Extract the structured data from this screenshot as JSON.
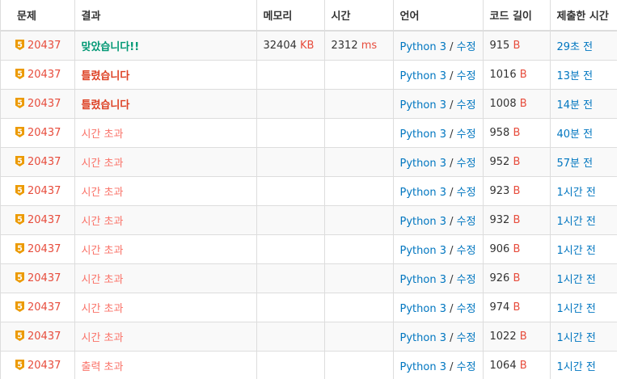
{
  "columns": {
    "problem": "문제",
    "result": "결과",
    "memory": "메모리",
    "time": "시간",
    "language": "언어",
    "code_length": "코드 길이",
    "submitted": "제출한 시간"
  },
  "colors": {
    "accepted": "#009874",
    "wrong": "#dd4124",
    "timeout": "#fa7268",
    "link": "#0076c0",
    "tier_gold": "#ec9a00"
  },
  "rows": [
    {
      "tier": "5",
      "problem": "20437",
      "result": "맞았습니다!!",
      "result_type": "ac",
      "memory": "32404",
      "memory_unit": "KB",
      "time": "2312",
      "time_unit": "ms",
      "language": "Python 3",
      "separator": " / ",
      "edit": "수정",
      "length": "915",
      "length_unit": "B",
      "submitted": "29초 전"
    },
    {
      "tier": "5",
      "problem": "20437",
      "result": "틀렸습니다",
      "result_type": "wa",
      "memory": "",
      "memory_unit": "",
      "time": "",
      "time_unit": "",
      "language": "Python 3",
      "separator": " / ",
      "edit": "수정",
      "length": "1016",
      "length_unit": "B",
      "submitted": "13분 전"
    },
    {
      "tier": "5",
      "problem": "20437",
      "result": "틀렸습니다",
      "result_type": "wa",
      "memory": "",
      "memory_unit": "",
      "time": "",
      "time_unit": "",
      "language": "Python 3",
      "separator": " / ",
      "edit": "수정",
      "length": "1008",
      "length_unit": "B",
      "submitted": "14분 전"
    },
    {
      "tier": "5",
      "problem": "20437",
      "result": "시간 초과",
      "result_type": "tle",
      "memory": "",
      "memory_unit": "",
      "time": "",
      "time_unit": "",
      "language": "Python 3",
      "separator": " / ",
      "edit": "수정",
      "length": "958",
      "length_unit": "B",
      "submitted": "40분 전"
    },
    {
      "tier": "5",
      "problem": "20437",
      "result": "시간 초과",
      "result_type": "tle",
      "memory": "",
      "memory_unit": "",
      "time": "",
      "time_unit": "",
      "language": "Python 3",
      "separator": " / ",
      "edit": "수정",
      "length": "952",
      "length_unit": "B",
      "submitted": "57분 전"
    },
    {
      "tier": "5",
      "problem": "20437",
      "result": "시간 초과",
      "result_type": "tle",
      "memory": "",
      "memory_unit": "",
      "time": "",
      "time_unit": "",
      "language": "Python 3",
      "separator": " / ",
      "edit": "수정",
      "length": "923",
      "length_unit": "B",
      "submitted": "1시간 전"
    },
    {
      "tier": "5",
      "problem": "20437",
      "result": "시간 초과",
      "result_type": "tle",
      "memory": "",
      "memory_unit": "",
      "time": "",
      "time_unit": "",
      "language": "Python 3",
      "separator": " / ",
      "edit": "수정",
      "length": "932",
      "length_unit": "B",
      "submitted": "1시간 전"
    },
    {
      "tier": "5",
      "problem": "20437",
      "result": "시간 초과",
      "result_type": "tle",
      "memory": "",
      "memory_unit": "",
      "time": "",
      "time_unit": "",
      "language": "Python 3",
      "separator": " / ",
      "edit": "수정",
      "length": "906",
      "length_unit": "B",
      "submitted": "1시간 전"
    },
    {
      "tier": "5",
      "problem": "20437",
      "result": "시간 초과",
      "result_type": "tle",
      "memory": "",
      "memory_unit": "",
      "time": "",
      "time_unit": "",
      "language": "Python 3",
      "separator": " / ",
      "edit": "수정",
      "length": "926",
      "length_unit": "B",
      "submitted": "1시간 전"
    },
    {
      "tier": "5",
      "problem": "20437",
      "result": "시간 초과",
      "result_type": "tle",
      "memory": "",
      "memory_unit": "",
      "time": "",
      "time_unit": "",
      "language": "Python 3",
      "separator": " / ",
      "edit": "수정",
      "length": "974",
      "length_unit": "B",
      "submitted": "1시간 전"
    },
    {
      "tier": "5",
      "problem": "20437",
      "result": "시간 초과",
      "result_type": "tle",
      "memory": "",
      "memory_unit": "",
      "time": "",
      "time_unit": "",
      "language": "Python 3",
      "separator": " / ",
      "edit": "수정",
      "length": "1022",
      "length_unit": "B",
      "submitted": "1시간 전"
    },
    {
      "tier": "5",
      "problem": "20437",
      "result": "출력 초과",
      "result_type": "ole",
      "memory": "",
      "memory_unit": "",
      "time": "",
      "time_unit": "",
      "language": "Python 3",
      "separator": " / ",
      "edit": "수정",
      "length": "1064",
      "length_unit": "B",
      "submitted": "1시간 전"
    }
  ]
}
